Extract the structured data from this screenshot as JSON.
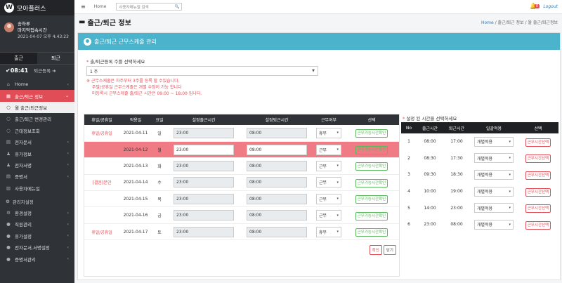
{
  "app": {
    "logo_letter": "W",
    "name": "모아플러스"
  },
  "user": {
    "name": "송하루",
    "last_login_label": "마지막접속시간",
    "last_login": "2021-04-07 오후 4:43:23"
  },
  "attendance": {
    "tab_in": "출근",
    "tab_out": "퇴근",
    "check_icon": "✔",
    "in_time": "08:41",
    "out_label": "퇴근등록",
    "out_icon": "➜"
  },
  "nav": {
    "home": "Home",
    "commute": "출근/퇴근 정보",
    "sub_week": "월 출근/퇴근정보",
    "change_mgmt": "출근/퇴근 변경관리",
    "work_info": "근태정보조회",
    "edoc": "전자문서",
    "vacation": "휴가정보",
    "esign": "전자서명",
    "certificate": "증명서",
    "manual": "사용자메뉴얼",
    "admin_header": "관리자설정",
    "env": "환경설정",
    "staff": "직원관리",
    "vac_setting": "휴가설정",
    "edoc_sign_setting": "전자문서,서명설정",
    "cert_mgmt": "증명서관리"
  },
  "topbar": {
    "home": "Home",
    "search_placeholder": "사용자메뉴얼 검색",
    "search_icon": "🔍",
    "bell_count": "0",
    "logout": "Logout"
  },
  "header": {
    "title": "출근/퇴근 정보",
    "breadcrumb": {
      "home": "Home",
      "sep": " / ",
      "level1": "출근/퇴근 정보",
      "level2": "월 출근/퇴근정보"
    }
  },
  "card": {
    "title": "출근/퇴근 근무스케줄 관리",
    "week_label": "출/퇴근등록 주를 선택하세요",
    "week_value": "1 주",
    "notes": [
      "※ 근무스케줄은 차주부터 3주를 등록 할 수있습니다.",
      "주말/공휴일 근무스케줄은 개별 수정이 가능 합니다",
      "미등록시 근무스케줄 출/퇴근 시간은 09:00 ~ 18:00 입니다."
    ],
    "confirm": "확인",
    "close": "닫기"
  },
  "schedule": {
    "headers": [
      "휴일/공휴일",
      "적용일",
      "요일",
      "설정출근시간",
      "설정퇴근시간",
      "근무여부",
      "선택"
    ],
    "check_label": "근무가능시간확인",
    "rows": [
      {
        "holiday": "휴일/공휴일",
        "date": "2021-04-11",
        "dow": "일",
        "in": "23:00",
        "out": "08:00",
        "work": "휴무"
      },
      {
        "holiday": "",
        "date": "2021-04-12",
        "dow": "월",
        "in": "23:00",
        "out": "08:00",
        "work": "근무"
      },
      {
        "holiday": "",
        "date": "2021-04-13",
        "dow": "화",
        "in": "23:00",
        "out": "08:00",
        "work": "근무"
      },
      {
        "holiday": "[결혼]본인",
        "date": "2021-04-14",
        "dow": "수",
        "in": "23:00",
        "out": "08:00",
        "work": "근무"
      },
      {
        "holiday": "",
        "date": "2021-04-15",
        "dow": "목",
        "in": "23:00",
        "out": "08:00",
        "work": "근무"
      },
      {
        "holiday": "",
        "date": "2021-04-16",
        "dow": "금",
        "in": "23:00",
        "out": "08:00",
        "work": "근무"
      },
      {
        "holiday": "휴일/공휴일",
        "date": "2021-04-17",
        "dow": "토",
        "in": "23:00",
        "out": "08:00",
        "work": "휴무"
      }
    ]
  },
  "preset": {
    "label": "설정 된 시간을 선택하세요",
    "headers": [
      "No",
      "출근시간",
      "퇴근시간",
      "일괄적용",
      "선택"
    ],
    "apply_value": "개별적용",
    "select_label": "근무시간선택",
    "rows": [
      {
        "no": "1",
        "in": "08:00",
        "out": "17:00"
      },
      {
        "no": "2",
        "in": "08:30",
        "out": "17:30"
      },
      {
        "no": "3",
        "in": "09:30",
        "out": "18:30"
      },
      {
        "no": "4",
        "in": "10:00",
        "out": "19:00"
      },
      {
        "no": "5",
        "in": "14:00",
        "out": "23:00"
      },
      {
        "no": "6",
        "in": "23:00",
        "out": "08:00"
      }
    ]
  },
  "colors": {
    "accent": "#e14d57",
    "header": "#4bb3cc",
    "sidebar": "#2f3237"
  }
}
